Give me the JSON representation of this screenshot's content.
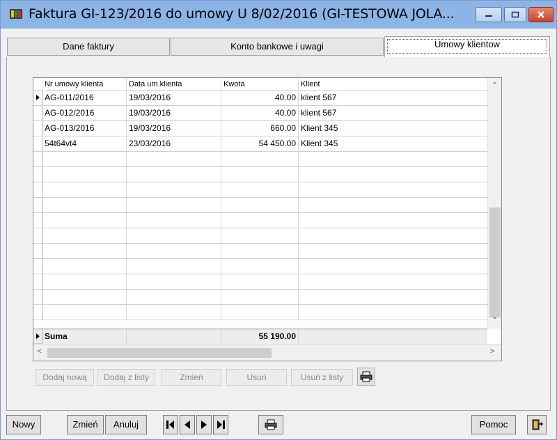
{
  "window": {
    "title": "Faktura GI-123/2016 do umowy U 8/02/2016 (GI-TESTOWA JOLA..."
  },
  "tabs": [
    {
      "label": "Dane faktury"
    },
    {
      "label": "Konto bankowe i uwagi"
    },
    {
      "label": "Umowy klientow"
    }
  ],
  "grid": {
    "columns": [
      "Nr umowy klienta",
      "Data um.klienta",
      "Kwota",
      "Klient"
    ],
    "rows": [
      {
        "nr": "AG-011/2016",
        "data": "19/03/2016",
        "kwota": "40.00",
        "klient": "klient 567"
      },
      {
        "nr": "AG-012/2016",
        "data": "19/03/2016",
        "kwota": "40.00",
        "klient": "klient 567"
      },
      {
        "nr": "AG-013/2016",
        "data": "19/03/2016",
        "kwota": "660.00",
        "klient": "Klient 345"
      },
      {
        "nr": "54t64vt4",
        "data": "23/03/2016",
        "kwota": "54 450.00",
        "klient": "Klient 345"
      }
    ],
    "sum_label": "Suma",
    "sum_value": "55 190.00"
  },
  "actions": {
    "dodaj_nowa": "Dodaj nową",
    "dodaj_z_listy": "Dodaj z listy",
    "zmien": "Zmień",
    "usun": "Usuń",
    "usun_z_listy": "Usuń z listy"
  },
  "bottom": {
    "nowy": "Nowy",
    "zmien": "Zmień",
    "anuluj": "Anuluj",
    "pomoc": "Pomoc"
  },
  "colors": {
    "titlebar": "#8cb4e6",
    "close_button": "#c8422a"
  }
}
